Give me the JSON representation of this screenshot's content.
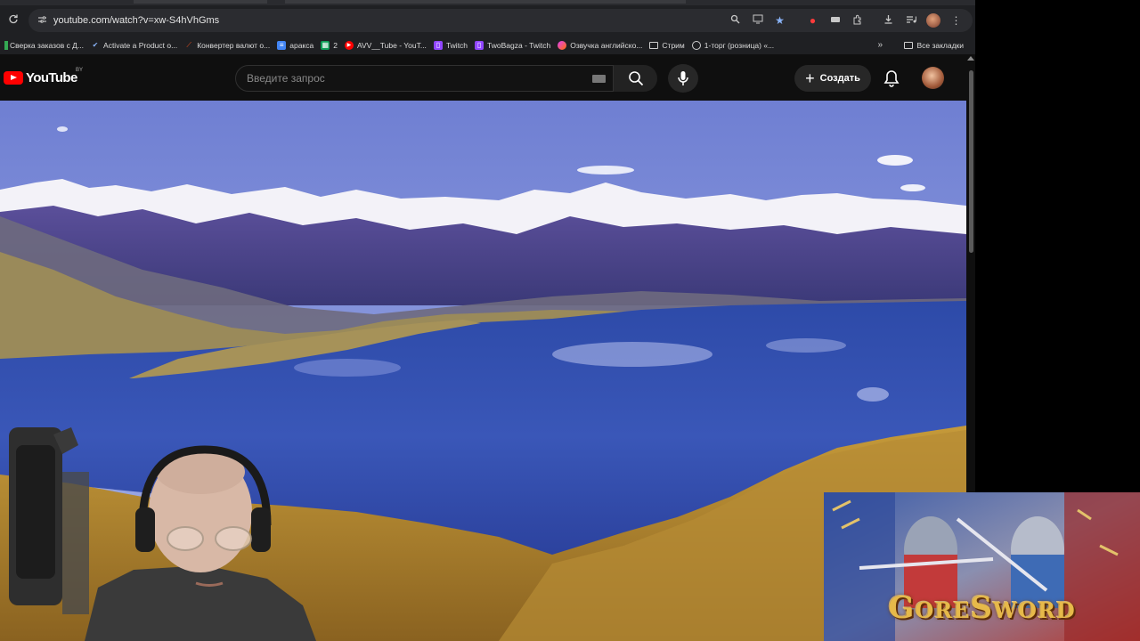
{
  "browser": {
    "url": "youtube.com/watch?v=xw-S4hVhGms",
    "bookmarks": [
      {
        "label": "Сверка заказов с Д...",
        "icon_color": "#34a853"
      },
      {
        "label": "Activate a Product o...",
        "icon_color": "#9aa0a6"
      },
      {
        "label": "Конвертер валют о...",
        "icon_color": "#f4511e"
      },
      {
        "label": "аракса",
        "icon_color": "#4285f4"
      },
      {
        "label": "2",
        "icon_color": "#0f9d58"
      },
      {
        "label": "AVV__Tube - YouT...",
        "icon_color": "#ff0000"
      },
      {
        "label": "Twitch",
        "icon_color": "#9146ff"
      },
      {
        "label": "TwoBagza - Twitch",
        "icon_color": "#9146ff"
      },
      {
        "label": "Озвучка английско...",
        "icon_color": "#e040fb"
      },
      {
        "label": "Стрим",
        "icon_color": "folder"
      },
      {
        "label": "1-торг (розница) «...",
        "icon_color": "#9aa0a6"
      }
    ],
    "all_bookmarks": "Все закладки"
  },
  "youtube": {
    "logo_text": "YouTube",
    "country_code": "BY",
    "search_placeholder": "Введите запрос",
    "create_label": "Создать"
  },
  "stream_overlay": {
    "game_title": "GoreSword"
  }
}
